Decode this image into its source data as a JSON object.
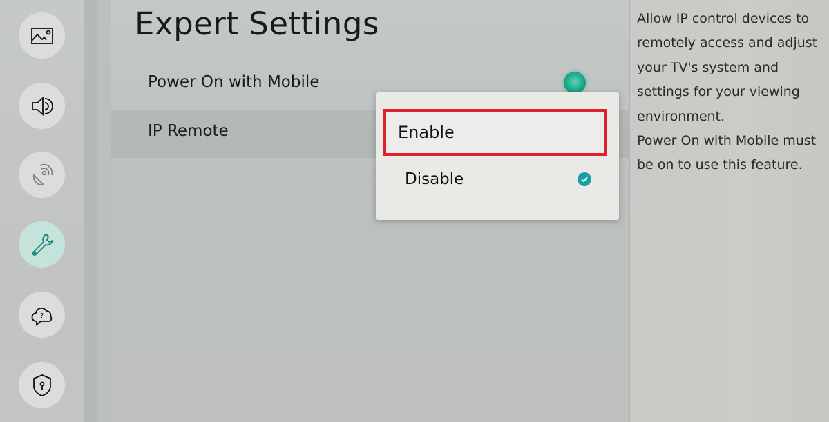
{
  "sidebar": {
    "items": [
      {
        "id": "picture",
        "icon": "picture-icon",
        "active": false
      },
      {
        "id": "sound",
        "icon": "speaker-icon",
        "active": false
      },
      {
        "id": "broadcasting",
        "icon": "satellite-dish-icon",
        "active": false,
        "dimmed": true
      },
      {
        "id": "general",
        "icon": "wrench-icon",
        "active": true
      },
      {
        "id": "support",
        "icon": "cloud-question-icon",
        "active": false
      },
      {
        "id": "privacy",
        "icon": "shield-keyhole-icon",
        "active": false
      }
    ]
  },
  "main": {
    "title": "Expert Settings",
    "rows": [
      {
        "label": "Power On with Mobile",
        "state": "on"
      },
      {
        "label": "IP Remote"
      }
    ]
  },
  "popup": {
    "options": [
      {
        "label": "Enable",
        "highlighted": true,
        "selected": false
      },
      {
        "label": "Disable",
        "highlighted": false,
        "selected": true
      }
    ]
  },
  "description": {
    "paragraph1": "Allow IP control devices to remotely access and adjust your TV's system and settings for your viewing environment.",
    "paragraph2": "Power On with Mobile must be on to use this feature."
  },
  "colors": {
    "accent": "#1aa88a",
    "highlight_border": "#e0202b",
    "check": "#1a9ea6"
  }
}
